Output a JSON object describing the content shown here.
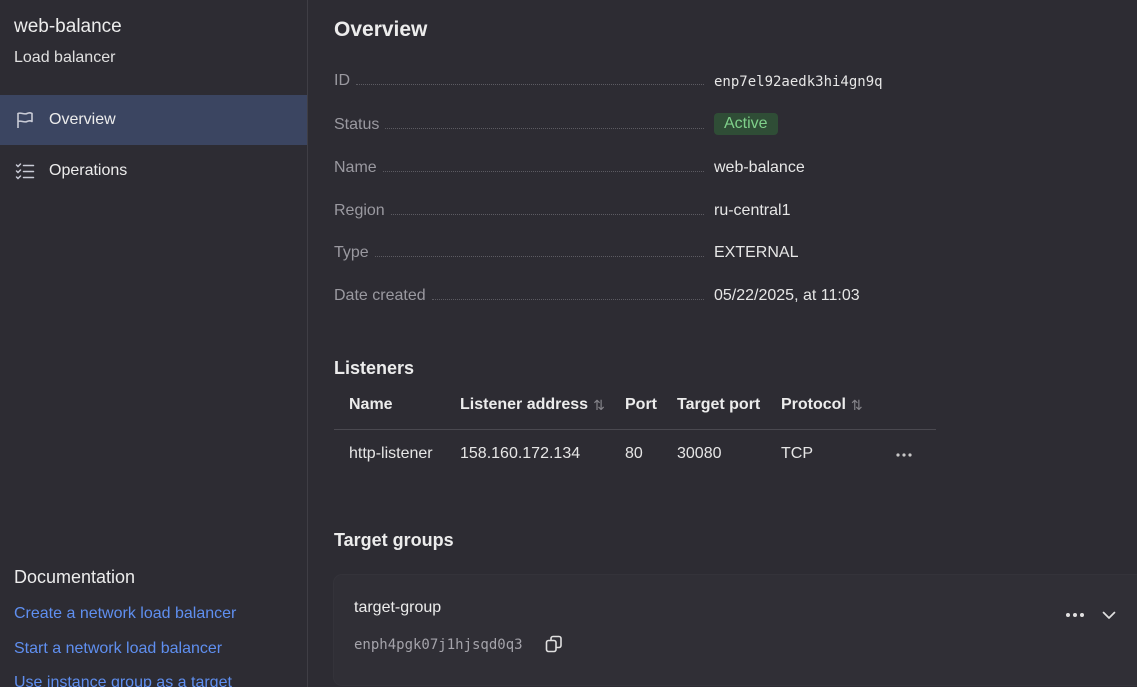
{
  "sidebar": {
    "title": "web-balance",
    "subtitle": "Load balancer",
    "nav": [
      {
        "label": "Overview",
        "icon": "flag-icon",
        "active": true
      },
      {
        "label": "Operations",
        "icon": "checklist-icon",
        "active": false
      }
    ],
    "docs": {
      "title": "Documentation",
      "links": [
        "Create a network load balancer",
        "Start a network load balancer",
        "Use instance group as a target"
      ]
    }
  },
  "overview": {
    "title": "Overview",
    "props": [
      {
        "key": "ID",
        "value": "enp7el92aedk3hi4gn9q"
      },
      {
        "key": "Status",
        "value": "Active"
      },
      {
        "key": "Name",
        "value": "web-balance"
      },
      {
        "key": "Region",
        "value": "ru-central1"
      },
      {
        "key": "Type",
        "value": "EXTERNAL"
      },
      {
        "key": "Date created",
        "value": "05/22/2025, at 11:03"
      }
    ]
  },
  "listeners": {
    "title": "Listeners",
    "columns": [
      "Name",
      "Listener address",
      "Port",
      "Target port",
      "Protocol"
    ],
    "rows": [
      {
        "name": "http-listener",
        "address": "158.160.172.134",
        "port": "80",
        "target_port": "30080",
        "protocol": "TCP"
      }
    ]
  },
  "target_groups": {
    "title": "Target groups",
    "items": [
      {
        "name": "target-group",
        "id": "enph4pgk07j1hjsqd0q3"
      }
    ]
  },
  "colors": {
    "background": "#2d2c33",
    "active_nav": "#3b4561",
    "link": "#5f8ff0",
    "status_active_bg": "#2f4d36",
    "status_active_text": "#7fd08a"
  }
}
